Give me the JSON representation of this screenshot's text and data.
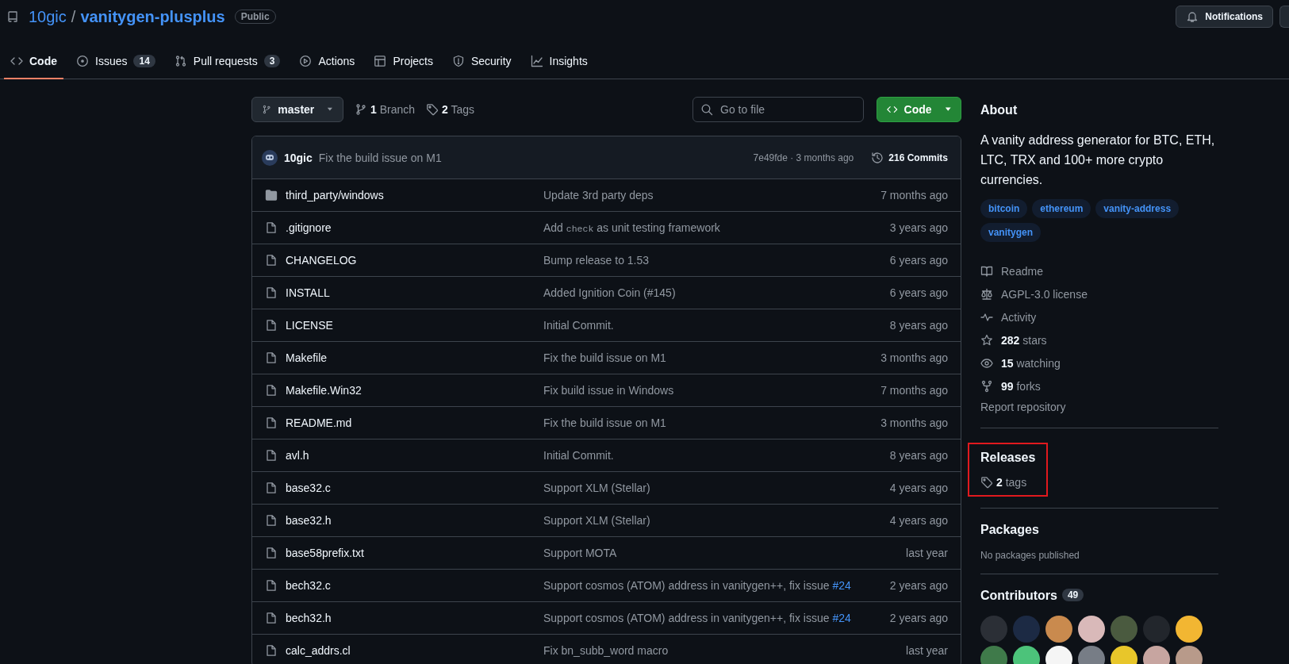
{
  "repo": {
    "owner": "10gic",
    "separator": "/",
    "name": "vanitygen-plusplus",
    "visibility": "Public"
  },
  "header_actions": [
    {
      "label": "Notifications"
    }
  ],
  "tabs": [
    {
      "label": "Code",
      "selected": true
    },
    {
      "label": "Issues",
      "count": "14",
      "selected": false
    },
    {
      "label": "Pull requests",
      "count": "3",
      "selected": false
    },
    {
      "label": "Actions",
      "selected": false
    },
    {
      "label": "Projects",
      "selected": false
    },
    {
      "label": "Security",
      "selected": false
    },
    {
      "label": "Insights",
      "selected": false
    }
  ],
  "toolbar": {
    "branch": "master",
    "branches": {
      "count": "1",
      "label": "Branch"
    },
    "tags": {
      "count": "2",
      "label": "Tags"
    },
    "search": {
      "placeholder": "Go to file"
    },
    "code_button": "Code"
  },
  "latest_commit": {
    "author": "10gic",
    "message": "Fix the build issue on M1",
    "meta": "7e49fde · 3 months ago",
    "commits": "216 Commits"
  },
  "files": [
    {
      "kind": "dir",
      "name": "third_party/windows",
      "message": [
        {
          "text": "Update 3rd party deps"
        }
      ],
      "age": "7 months ago"
    },
    {
      "kind": "file",
      "name": ".gitignore",
      "message": [
        {
          "text": "Add "
        },
        {
          "kind": "code",
          "text": "check"
        },
        {
          "text": " as unit testing framework"
        }
      ],
      "age": "3 years ago"
    },
    {
      "kind": "file",
      "name": "CHANGELOG",
      "message": [
        {
          "text": "Bump release to 1.53"
        }
      ],
      "age": "6 years ago"
    },
    {
      "kind": "file",
      "name": "INSTALL",
      "message": [
        {
          "text": "Added Ignition Coin (#145)"
        }
      ],
      "age": "6 years ago"
    },
    {
      "kind": "file",
      "name": "LICENSE",
      "message": [
        {
          "text": "Initial Commit."
        }
      ],
      "age": "8 years ago"
    },
    {
      "kind": "file",
      "name": "Makefile",
      "message": [
        {
          "text": "Fix the build issue on M1"
        }
      ],
      "age": "3 months ago"
    },
    {
      "kind": "file",
      "name": "Makefile.Win32",
      "message": [
        {
          "text": "Fix build issue in Windows"
        }
      ],
      "age": "7 months ago"
    },
    {
      "kind": "file",
      "name": "README.md",
      "message": [
        {
          "text": "Fix the build issue on M1"
        }
      ],
      "age": "3 months ago"
    },
    {
      "kind": "file",
      "name": "avl.h",
      "message": [
        {
          "text": "Initial Commit."
        }
      ],
      "age": "8 years ago"
    },
    {
      "kind": "file",
      "name": "base32.c",
      "message": [
        {
          "text": "Support XLM (Stellar)"
        }
      ],
      "age": "4 years ago"
    },
    {
      "kind": "file",
      "name": "base32.h",
      "message": [
        {
          "text": "Support XLM (Stellar)"
        }
      ],
      "age": "4 years ago"
    },
    {
      "kind": "file",
      "name": "base58prefix.txt",
      "message": [
        {
          "text": "Support MOTA"
        }
      ],
      "age": "last year"
    },
    {
      "kind": "file",
      "name": "bech32.c",
      "message": [
        {
          "text": "Support cosmos (ATOM) address in vanitygen++, fix issue "
        },
        {
          "kind": "link",
          "text": "#24"
        }
      ],
      "age": "2 years ago"
    },
    {
      "kind": "file",
      "name": "bech32.h",
      "message": [
        {
          "text": "Support cosmos (ATOM) address in vanitygen++, fix issue "
        },
        {
          "kind": "link",
          "text": "#24"
        }
      ],
      "age": "2 years ago"
    },
    {
      "kind": "file",
      "name": "calc_addrs.cl",
      "message": [
        {
          "text": "Fix bn_subb_word macro"
        }
      ],
      "age": "last year"
    }
  ],
  "about": {
    "title": "About",
    "description": "A vanity address generator for BTC, ETH, LTC, TRX and 100+ more crypto currencies.",
    "topics": [
      "bitcoin",
      "ethereum",
      "vanity-address",
      "vanitygen"
    ],
    "links": [
      {
        "label": "Readme"
      },
      {
        "label": "AGPL-3.0 license"
      },
      {
        "label": "Activity"
      },
      {
        "count": "282",
        "label": "stars"
      },
      {
        "count": "15",
        "label": "watching"
      },
      {
        "count": "99",
        "label": "forks"
      }
    ],
    "report": "Report repository"
  },
  "releases": {
    "title": "Releases",
    "count": "2",
    "label": "tags",
    "highlighted": true
  },
  "packages": {
    "title": "Packages",
    "note": "No packages published"
  },
  "contributors": {
    "title": "Contributors",
    "count": "49",
    "avatars": [
      {
        "color": "#2b2f36"
      },
      {
        "color": "#1c2a44"
      },
      {
        "color": "#c98a4e"
      },
      {
        "color": "#d9b9b9"
      },
      {
        "color": "#4a5a3f"
      },
      {
        "color": "#22262c"
      },
      {
        "color": "#f2b632"
      },
      {
        "color": "#3f7a4a"
      },
      {
        "color": "#4cc37a"
      },
      {
        "color": "#f5f5f5"
      },
      {
        "color": "#777d86"
      },
      {
        "color": "#e8c62a"
      },
      {
        "color": "#c7a5a0"
      },
      {
        "color": "#b89a8a"
      }
    ]
  }
}
